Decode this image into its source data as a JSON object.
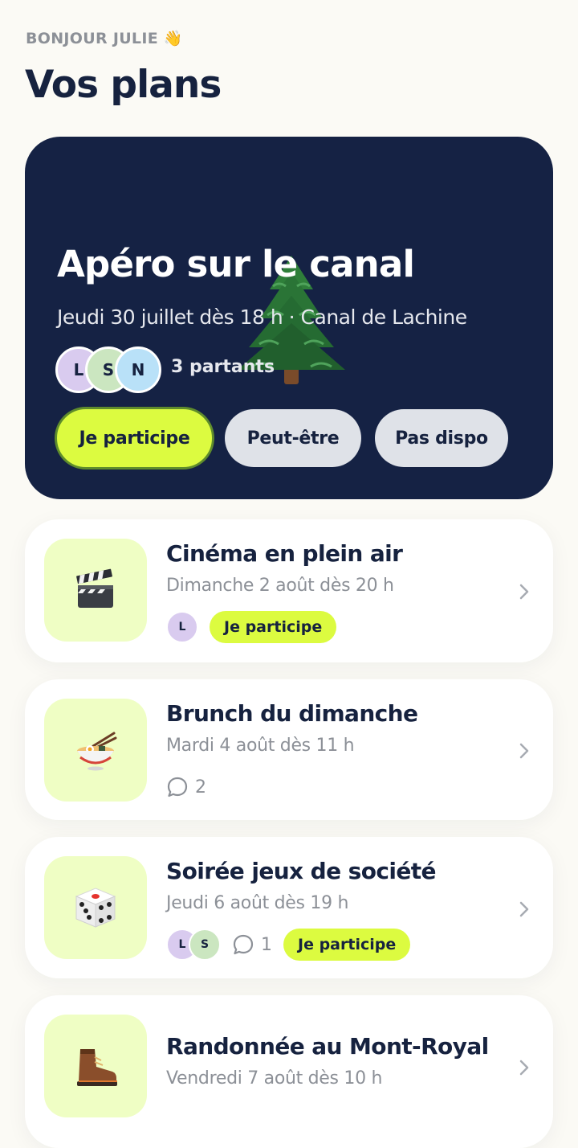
{
  "header": {
    "greeting": "BONJOUR JULIE 👋",
    "title": "Vos plans"
  },
  "featured": {
    "icon": "evergreen-tree-icon",
    "title": "Apéro sur le canal",
    "subtitle": "Jeudi 30 juillet dès 18 h · Canal de Lachine",
    "avatars": [
      "L",
      "S",
      "N"
    ],
    "participants_label": "3 partants",
    "actions": {
      "yes": "Je participe",
      "maybe": "Peut-être",
      "no": "Pas dispo"
    },
    "selected_action": "yes"
  },
  "plans": [
    {
      "icon": "clapperboard-icon",
      "title": "Cinéma en plein air",
      "date": "Dimanche 2 août dès 20 h",
      "avatars": [
        "L"
      ],
      "status": "Je participe"
    },
    {
      "icon": "ramen-bowl-icon",
      "title": "Brunch du dimanche",
      "date": "Mardi 4 août dès 11 h",
      "comments": "2"
    },
    {
      "icon": "die-icon",
      "title": "Soirée jeux de société",
      "date": "Jeudi 6 août dès 19 h",
      "avatars": [
        "L",
        "S"
      ],
      "comments": "1",
      "status": "Je participe"
    },
    {
      "icon": "hiking-boot-icon",
      "title": "Randonnée au Mont-Royal",
      "date": "Vendredi 7 août dès 10 h"
    }
  ],
  "colors": {
    "background": "#fbfaf5",
    "navy": "#152244",
    "lime": "#dcfb40",
    "thumb": "#effec4",
    "muted": "#8c9097"
  }
}
